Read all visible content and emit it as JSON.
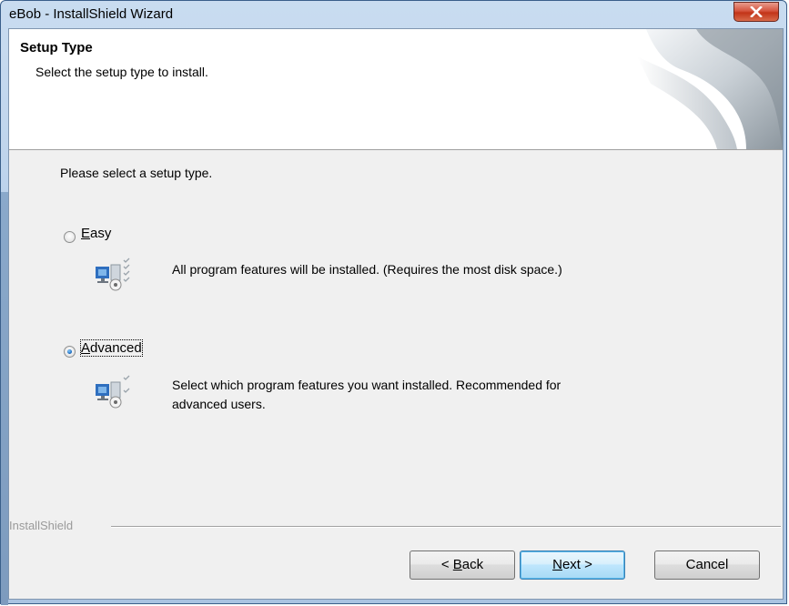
{
  "window": {
    "title": "eBob - InstallShield Wizard"
  },
  "header": {
    "title": "Setup Type",
    "subtitle": "Select the setup type to install."
  },
  "body": {
    "prompt": "Please select a setup type."
  },
  "options": [
    {
      "label_mnemonic": "E",
      "label_rest": "asy",
      "description_line1": "All program features will be installed. (Requires the most disk space.)",
      "description_line2": "",
      "selected": false,
      "icon": "setup-easy-icon"
    },
    {
      "label_mnemonic": "A",
      "label_rest": "dvanced",
      "description_line1": "Select which program features you want installed. Recommended for",
      "description_line2": "advanced users.",
      "selected": true,
      "icon": "setup-advanced-icon"
    }
  ],
  "footer": {
    "brand": "InstallShield"
  },
  "buttons": {
    "back_prefix": "< ",
    "back_mnemonic": "B",
    "back_rest": "ack",
    "next_mnemonic": "N",
    "next_rest": "ext >",
    "cancel": "Cancel"
  },
  "colors": {
    "title_bar": "#b9d0ea",
    "close_button": "#c23418",
    "default_button_border": "#3c7fb1",
    "dialog_background": "#f0f0f0"
  }
}
